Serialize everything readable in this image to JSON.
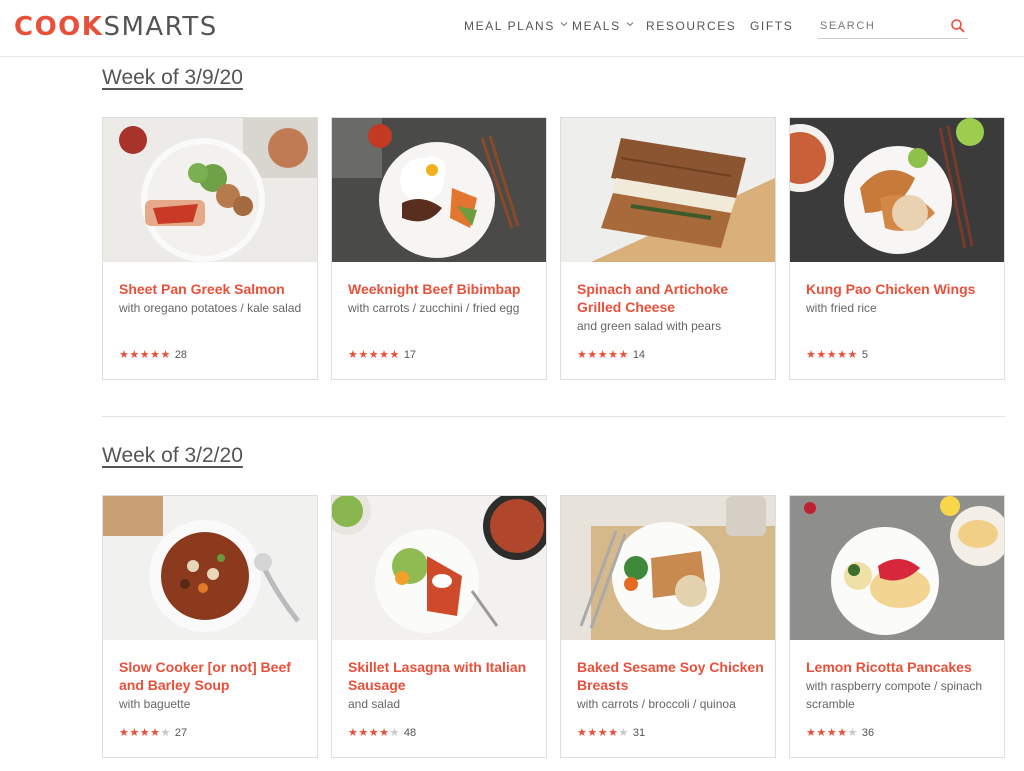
{
  "header": {
    "logo_part1": "COOK",
    "logo_part2": "SMARTS",
    "nav": [
      {
        "label": "MEAL PLANS",
        "dropdown": true
      },
      {
        "label": "MEALS",
        "dropdown": true
      },
      {
        "label": "RESOURCES",
        "dropdown": false
      },
      {
        "label": "GIFTS",
        "dropdown": false
      }
    ],
    "search_placeholder": "SEARCH"
  },
  "colors": {
    "accent": "#e8503a",
    "text": "#555555",
    "star_off": "#c8c8c8"
  },
  "weeks": [
    {
      "title": "Week of 3/9/20",
      "meals": [
        {
          "title": "Sheet Pan Greek Salmon",
          "subtitle": "with oregano potatoes / kale salad",
          "stars": 5,
          "reviews": "28",
          "photo": "salmon-plate"
        },
        {
          "title": "Weeknight Beef Bibimbap",
          "subtitle": "with carrots / zucchini / fried egg",
          "stars": 5,
          "reviews": "17",
          "photo": "bibimbap-plate"
        },
        {
          "title": "Spinach and Artichoke Grilled Cheese",
          "subtitle": "and green salad with pears",
          "stars": 5,
          "reviews": "14",
          "photo": "grilled-cheese"
        },
        {
          "title": "Kung Pao Chicken Wings",
          "subtitle": "with fried rice",
          "stars": 5,
          "reviews": "5",
          "photo": "chicken-wings-plate"
        }
      ]
    },
    {
      "title": "Week of 3/2/20",
      "meals": [
        {
          "title": "Slow Cooker [or not] Beef and Barley Soup",
          "subtitle": "with baguette",
          "stars": 4,
          "reviews": "27",
          "photo": "soup-bowl"
        },
        {
          "title": "Skillet Lasagna with Italian Sausage",
          "subtitle": "and salad",
          "stars": 4,
          "reviews": "48",
          "photo": "lasagna-plate"
        },
        {
          "title": "Baked Sesame Soy Chicken Breasts",
          "subtitle": "with carrots / broccoli / quinoa",
          "stars": 4,
          "reviews": "31",
          "photo": "chicken-breast-plate"
        },
        {
          "title": "Lemon Ricotta Pancakes",
          "subtitle": "with raspberry compote / spinach scramble",
          "stars": 4,
          "reviews": "36",
          "photo": "pancakes-plate"
        }
      ]
    }
  ]
}
